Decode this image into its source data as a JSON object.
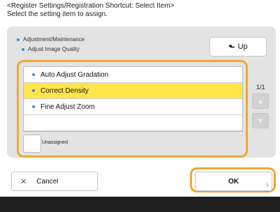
{
  "header": {
    "line1": "<Register Settings/Registration Shortcut: Select Item>",
    "line2": "Select the setting item to assign."
  },
  "breadcrumb": {
    "level1": "Adjustment/Maintenance",
    "level2": "Adjust Image Quality"
  },
  "up_button": {
    "icon": "up-arrow-icon",
    "label": "Up"
  },
  "list": {
    "items": [
      {
        "label": "Auto Adjust Gradation",
        "selected": false
      },
      {
        "label": "Correct Density",
        "selected": true
      },
      {
        "label": "Fine Adjust Zoom",
        "selected": false
      }
    ]
  },
  "unassigned": {
    "label": "Unassigned"
  },
  "pagination": {
    "page": "1/1"
  },
  "footer": {
    "cancel_label": "Cancel",
    "ok_label": "OK"
  },
  "colors": {
    "accent": "#f0a830",
    "selected_row": "#ffe54a",
    "bullet": "#3a8fd8"
  }
}
